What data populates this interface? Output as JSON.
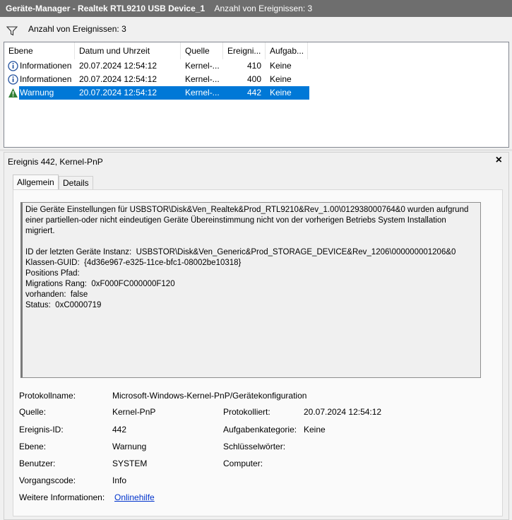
{
  "window": {
    "title": "Geräte-Manager - Realtek RTL9210 USB Device_1",
    "event_count": "Anzahl von Ereignissen: 3"
  },
  "filter": {
    "label": "Anzahl von Ereignissen: 3",
    "icon": "filter-icon"
  },
  "table": {
    "columns": [
      "Ebene",
      "Datum und Uhrzeit",
      "Quelle",
      "Ereigni...",
      "Aufgab..."
    ],
    "rows": [
      {
        "level": "Informationen",
        "datetime": "20.07.2024 12:54:12",
        "source": "Kernel-...",
        "event_id": "410",
        "task": "Keine",
        "icon": "info-icon"
      },
      {
        "level": "Informationen",
        "datetime": "20.07.2024 12:54:12",
        "source": "Kernel-...",
        "event_id": "400",
        "task": "Keine",
        "icon": "info-icon"
      },
      {
        "level": "Warnung",
        "datetime": "20.07.2024 12:54:12",
        "source": "Kernel-...",
        "event_id": "442",
        "task": "Keine",
        "icon": "warning-icon",
        "selected": true
      }
    ]
  },
  "detail": {
    "title": "Ereignis 442, Kernel-PnP",
    "close": "×",
    "tabs": [
      "Allgemein",
      "Details"
    ],
    "message": "Die Geräte Einstellungen für USBSTOR\\Disk&Ven_Realtek&Prod_RTL9210&Rev_1.00\\012938000764&0 wurden aufgrund\neiner partiellen-oder nicht eindeutigen Geräte Übereinstimmung nicht von der vorherigen Betriebs System Installation\nmigriert.\n\nID der letzten Geräte Instanz:  USBSTOR\\Disk&Ven_Generic&Prod_STORAGE_DEVICE&Rev_1206\\000000001206&0\nKlassen-GUID:  {4d36e967-e325-11ce-bfc1-08002be10318}\nPositions Pfad:\nMigrations Rang:  0xF000FC000000F120\nvorhanden:  false\nStatus:  0xC0000719",
    "props": {
      "protokollname_label": "Protokollname:",
      "protokollname": "Microsoft-Windows-Kernel-PnP/Gerätekonfiguration",
      "quelle_label": "Quelle:",
      "quelle": "Kernel-PnP",
      "protokolliert_label": "Protokolliert:",
      "protokolliert": "20.07.2024 12:54:12",
      "ereignis_id_label": "Ereignis-ID:",
      "ereignis_id": "442",
      "aufgabenkategorie_label": "Aufgabenkategorie:",
      "aufgabenkategorie": "Keine",
      "ebene_label": "Ebene:",
      "ebene": "Warnung",
      "schluesselwoerter_label": "Schlüsselwörter:",
      "benutzer_label": "Benutzer:",
      "benutzer": "SYSTEM",
      "computer_label": "Computer:",
      "vorgangscode_label": "Vorgangscode:",
      "vorgangscode": "Info",
      "weitere_label": "Weitere Informationen:",
      "onlinehilfe": "Onlinehilfe"
    }
  },
  "colors": {
    "selection": "#0078d7",
    "titlebar": "#6e6e6e",
    "link": "#0033cc"
  }
}
